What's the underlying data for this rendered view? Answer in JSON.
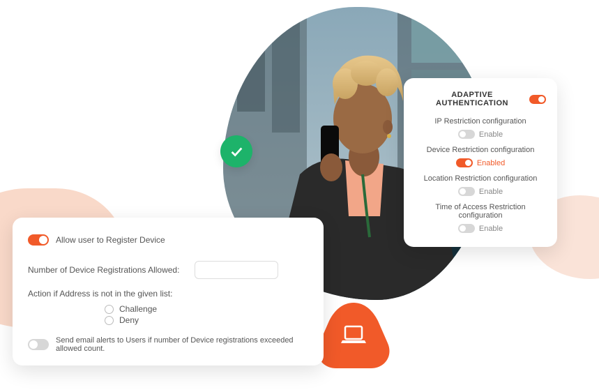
{
  "colors": {
    "accent": "#f15a29",
    "success": "#1db36a"
  },
  "leftCard": {
    "allow_register_label": "Allow user to Register Device",
    "allow_register_on": true,
    "num_reg_label": "Number of Device Registrations Allowed:",
    "num_reg_value": "",
    "action_label": "Action if Address is not in the given list:",
    "options": [
      {
        "label": "Challenge"
      },
      {
        "label": "Deny"
      }
    ],
    "email_alert_label": "Send email alerts to Users if number of Device registrations exceeded allowed count.",
    "email_alert_on": false
  },
  "rightCard": {
    "title": "ADAPTIVE AUTHENTICATION",
    "master_on": true,
    "items": [
      {
        "label": "IP Restriction configuration",
        "status_label": "Enable",
        "on": false
      },
      {
        "label": "Device Restriction configuration",
        "status_label": "Enabled",
        "on": true
      },
      {
        "label": "Location Restriction configuration",
        "status_label": "Enable",
        "on": false
      },
      {
        "label": "Time of Access Restriction configuration",
        "status_label": "Enable",
        "on": false
      }
    ]
  }
}
